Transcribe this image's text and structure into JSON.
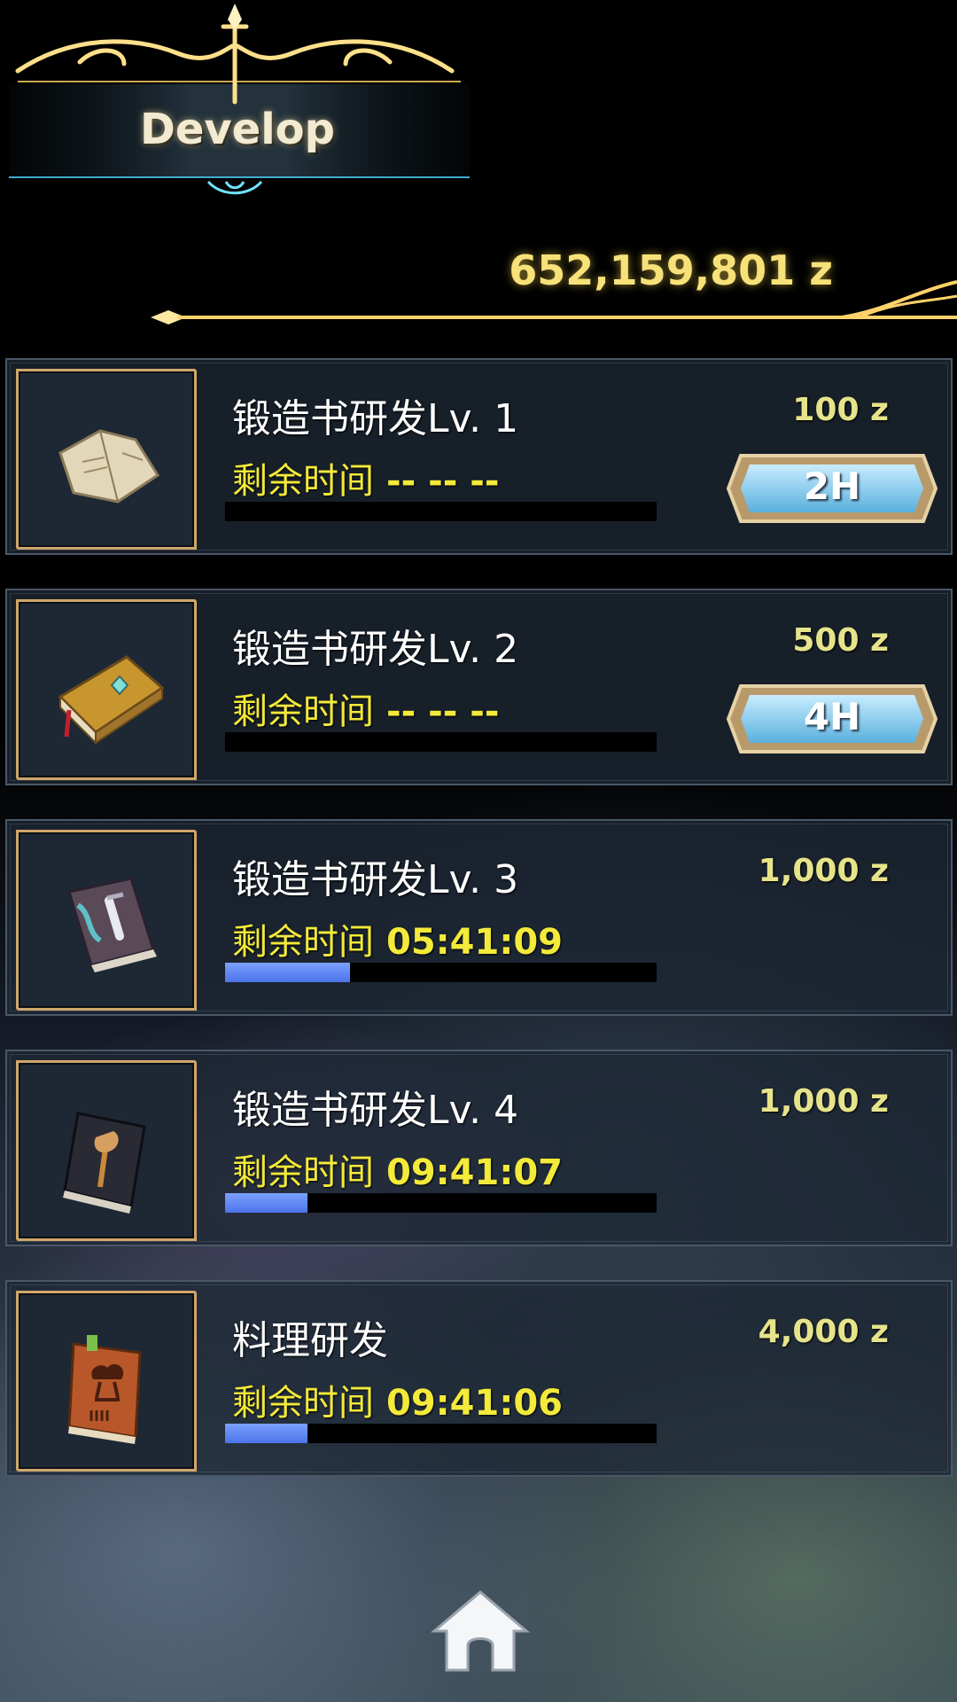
{
  "header": {
    "title": "Develop"
  },
  "currency": {
    "amount": "652,159,801 z"
  },
  "colors": {
    "gold": "#f7e27a",
    "timer_yellow": "#f3ea3a",
    "progress_blue": "#5a80f0",
    "frame_gold": "#cfa66a"
  },
  "research": {
    "remaining_label": "剩余时间",
    "items": [
      {
        "title": "锻造书研发Lv. 1",
        "cost": "100 z",
        "remaining": "-- -- --",
        "progress": 0,
        "button": "2H",
        "icon": "tattered-scroll-book-icon"
      },
      {
        "title": "锻造书研发Lv. 2",
        "cost": "500 z",
        "remaining": "-- -- --",
        "progress": 0,
        "button": "4H",
        "icon": "golden-book-icon"
      },
      {
        "title": "锻造书研发Lv. 3",
        "cost": "1,000 z",
        "remaining": "05:41:09",
        "progress": 0.29,
        "icon": "sword-book-icon"
      },
      {
        "title": "锻造书研发Lv. 4",
        "cost": "1,000 z",
        "remaining": "09:41:07",
        "progress": 0.19,
        "icon": "axe-book-icon"
      },
      {
        "title": "料理研发",
        "cost": "4,000 z",
        "remaining": "09:41:06",
        "progress": 0.19,
        "icon": "cooking-book-icon"
      }
    ]
  },
  "footer": {
    "home_icon": "home-icon"
  }
}
